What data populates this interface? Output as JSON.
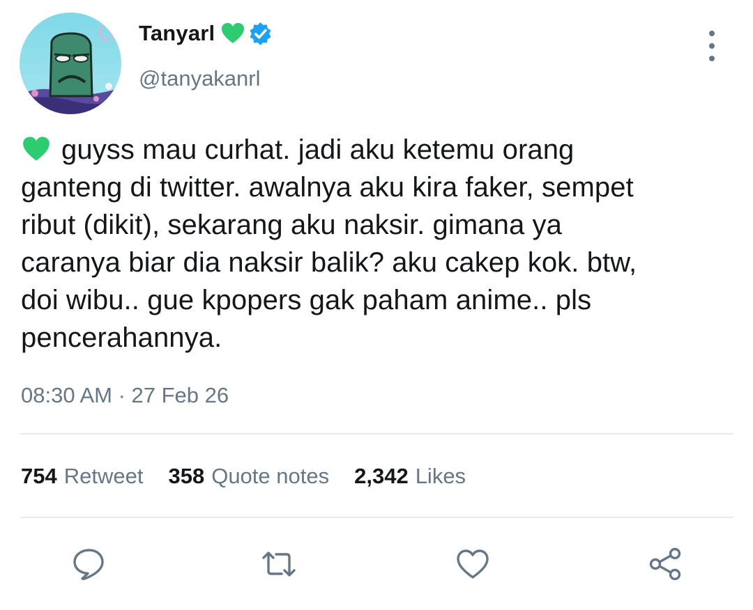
{
  "user": {
    "display_name": "Tanyarl",
    "handle": "@tanyakanrl",
    "verified": true,
    "badge_icon": "green-heart-icon",
    "avatar_icon": "cartoon-character-avatar"
  },
  "tweet": {
    "lines": [
      "guyss mau curhat. jadi aku ketemu orang",
      "ganteng di twitter. awalnya aku kira faker, sempet",
      "ribut (dikit), sekarang aku naksir. gimana ya",
      "caranya biar dia naksir balik? aku cakep kok. btw,",
      "doi wibu.. gue kpopers gak paham anime.. pls",
      "pencerahannya."
    ],
    "leading_icon": "green-heart-icon",
    "timestamp": "08:30 AM · 27 Feb 26"
  },
  "stats": [
    {
      "count": "754",
      "label": "Retweet"
    },
    {
      "count": "358",
      "label": "Quote notes"
    },
    {
      "count": "2,342",
      "label": "Likes"
    }
  ],
  "actions": [
    "reply-icon",
    "retweet-icon",
    "like-icon",
    "share-icon"
  ],
  "colors": {
    "text_primary": "#14171a",
    "text_secondary": "#657786",
    "verified_blue": "#1da1f2",
    "heart_green": "#2ecc71",
    "divider": "#e6ecf0"
  }
}
